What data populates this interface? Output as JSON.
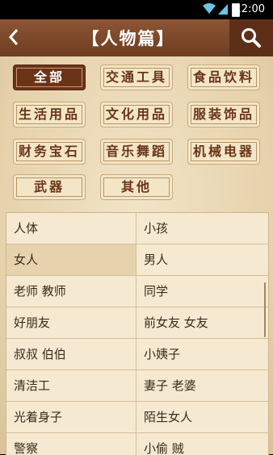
{
  "status": {
    "time": "12:00"
  },
  "header": {
    "title": "【人物篇】"
  },
  "categories": [
    {
      "label": "全部",
      "active": true
    },
    {
      "label": "交通工具"
    },
    {
      "label": "食品饮料"
    },
    {
      "label": "生活用品"
    },
    {
      "label": "文化用品"
    },
    {
      "label": "服装饰品"
    },
    {
      "label": "财务宝石"
    },
    {
      "label": "音乐舞蹈"
    },
    {
      "label": "机械电器"
    },
    {
      "label": "武器"
    },
    {
      "label": "其他"
    }
  ],
  "rows": [
    [
      "人体",
      "小孩"
    ],
    [
      "女人",
      "男人"
    ],
    [
      "老师 教师",
      "同学"
    ],
    [
      "好朋友",
      "前女友 女友"
    ],
    [
      "叔叔 伯伯",
      "小姨子"
    ],
    [
      "清洁工",
      "妻子 老婆"
    ],
    [
      "光着身子",
      "陌生女人"
    ],
    [
      "警察",
      "小偷 贼"
    ]
  ],
  "colors": {
    "header": "#7a4428",
    "accent": "#6b3418",
    "paper": "#ecdcb8"
  },
  "icons": {
    "back": "chevron-left-icon",
    "search": "search-icon"
  }
}
